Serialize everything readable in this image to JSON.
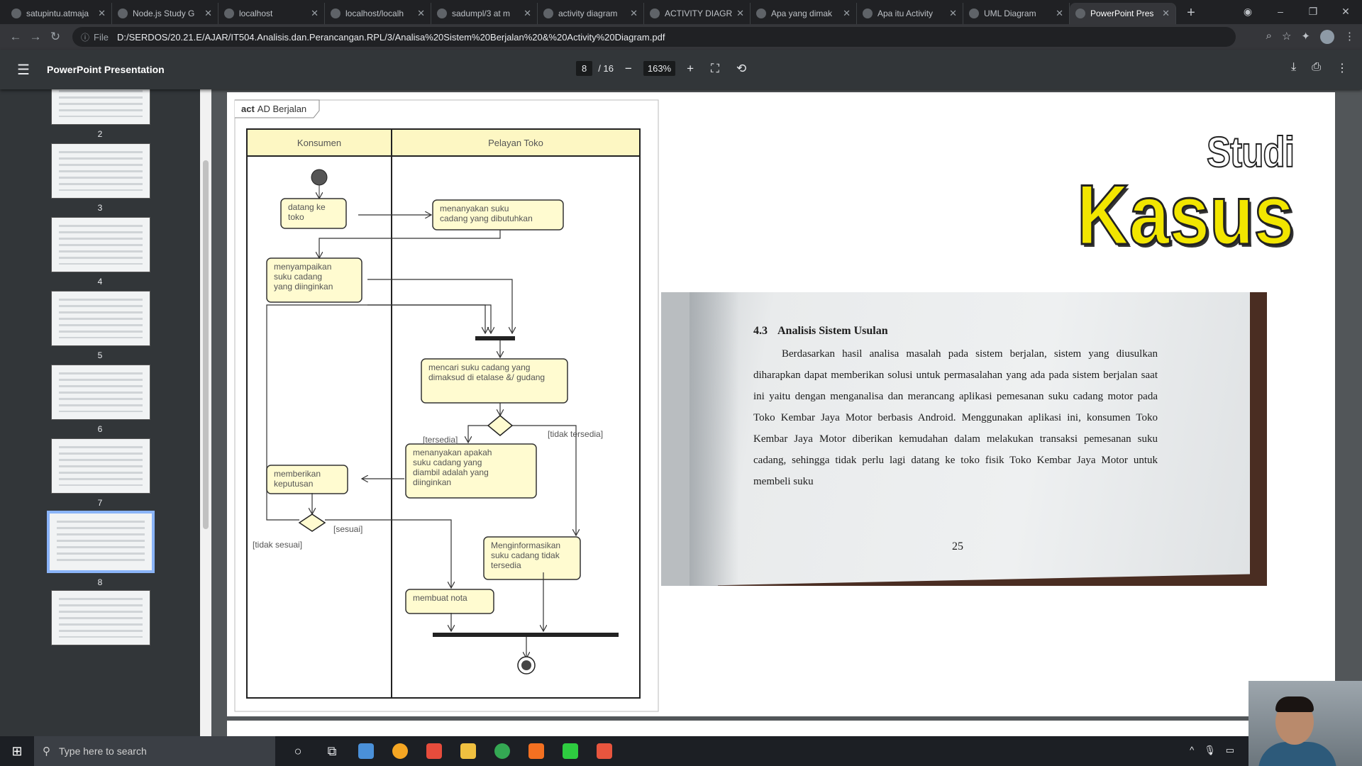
{
  "browser": {
    "tabs": [
      {
        "title": "satupintu.atmaja",
        "icon": "globe-icon"
      },
      {
        "title": "Node.js Study G",
        "icon": "doc-icon"
      },
      {
        "title": "localhost",
        "icon": "xampp-icon"
      },
      {
        "title": "localhost/localh",
        "icon": "pma-icon"
      },
      {
        "title": "sadumpl/3 at m",
        "icon": "github-icon"
      },
      {
        "title": "activity diagram",
        "icon": "google-icon"
      },
      {
        "title": "ACTIVITY DIAGR",
        "icon": "globe-icon"
      },
      {
        "title": "Apa yang dimak",
        "icon": "bracket-icon"
      },
      {
        "title": "Apa itu Activity",
        "icon": "dicoding-icon"
      },
      {
        "title": "UML Diagram",
        "icon": "globe-icon"
      },
      {
        "title": "PowerPoint Pres",
        "icon": "globe-icon",
        "active": true
      }
    ],
    "address": {
      "prefix": "File",
      "url": "D:/SERDOS/20.21.E/AJAR/IT504.Analisis.dan.Perancangan.RPL/3/Analisa%20Sistem%20Berjalan%20&%20Activity%20Diagram.pdf"
    }
  },
  "pdf": {
    "title": "PowerPoint Presentation",
    "page_current": "8",
    "page_total": "/ 16",
    "zoom": "163%",
    "thumbnails": [
      {
        "num": "2"
      },
      {
        "num": "3"
      },
      {
        "num": "4"
      },
      {
        "num": "5"
      },
      {
        "num": "6"
      },
      {
        "num": "7"
      },
      {
        "num": "8",
        "selected": true
      },
      {
        "num": ""
      }
    ]
  },
  "slide": {
    "diagram": {
      "frame_label_bold": "act",
      "frame_label": "AD Berjalan",
      "lane_left": "Konsumen",
      "lane_right": "Pelayan Toko",
      "actions": {
        "datang": [
          "datang ke",
          "toko"
        ],
        "menanyakan_suku": [
          "menanyakan suku",
          "cadang yang dibutuhkan"
        ],
        "menyampaikan": [
          "menyampaikan",
          "suku cadang",
          "yang diinginkan"
        ],
        "mencari": [
          "mencari suku cadang yang",
          "dimaksud di etalase &/ gudang"
        ],
        "menanyakan_apakah": [
          "menanyakan apakah",
          "suku cadang yang",
          "diambil adalah yang",
          "diinginkan"
        ],
        "memberikan": [
          "memberikan",
          "keputusan"
        ],
        "menginformasikan": [
          "Menginformasikan",
          "suku cadang tidak",
          "tersedia"
        ],
        "membuat_nota": [
          "membuat nota"
        ]
      },
      "guards": {
        "tersedia": "[tersedia]",
        "tidak_tersedia": "[tidak tersedia]",
        "sesuai": "[sesuai]",
        "tidak_sesuai": "[tidak sesuai]"
      }
    },
    "heading_line1": "Studi",
    "heading_line2": "Kasus",
    "book": {
      "section_num": "4.3",
      "section_title": "Analisis Sistem Usulan",
      "paragraph": "Berdasarkan hasil analisa masalah pada sistem berjalan, sistem yang diusulkan diharapkan dapat memberikan solusi untuk permasalahan yang ada pada sistem berjalan saat ini yaitu dengan menganalisa dan merancang aplikasi pemesanan suku cadang motor pada Toko Kembar Jaya Motor berbasis Android. Menggunakan aplikasi ini, konsumen Toko Kembar Jaya Motor diberikan kemudahan dalam melakukan transaksi pemesanan suku cadang, sehingga tidak perlu lagi datang ke toko fisik Toko Kembar Jaya Motor untuk membeli suku",
      "page_number": "25"
    }
  },
  "taskbar": {
    "search_placeholder": "Type here to search"
  },
  "colors": {
    "lane_header": "#fdf7c3",
    "action_fill": "#fffbd0",
    "kasus_yellow": "#f2e600"
  }
}
